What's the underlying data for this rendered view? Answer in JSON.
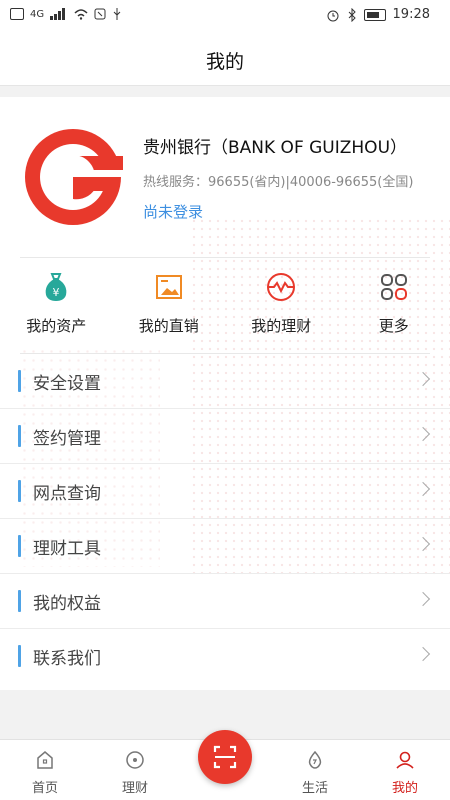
{
  "status_bar": {
    "time": "19:28",
    "network": "4G"
  },
  "header": {
    "title": "我的"
  },
  "profile": {
    "bank_name": "贵州银行（BANK OF GUIZHOU）",
    "hotline": "热线服务：96655(省内)|40006-96655(全国)",
    "login_text": "尚未登录"
  },
  "quick_actions": [
    {
      "label": "我的资产",
      "icon": "money-bag-icon"
    },
    {
      "label": "我的直销",
      "icon": "image-frame-icon"
    },
    {
      "label": "我的理财",
      "icon": "wallet-circle-icon"
    },
    {
      "label": "更多",
      "icon": "grid-icon"
    }
  ],
  "menu": [
    {
      "label": "安全设置"
    },
    {
      "label": "签约管理"
    },
    {
      "label": "网点查询"
    },
    {
      "label": "理财工具"
    },
    {
      "label": "我的权益"
    },
    {
      "label": "联系我们"
    }
  ],
  "tabbar": {
    "items": [
      {
        "label": "首页"
      },
      {
        "label": "理财"
      },
      {
        "label": "生活"
      },
      {
        "label": "我的"
      }
    ],
    "active": "我的"
  },
  "colors": {
    "brand_red": "#e8392c",
    "accent_blue": "#3d8fe0",
    "tab_active": "#d3211d",
    "teal": "#27a89a",
    "orange": "#f08a24"
  }
}
